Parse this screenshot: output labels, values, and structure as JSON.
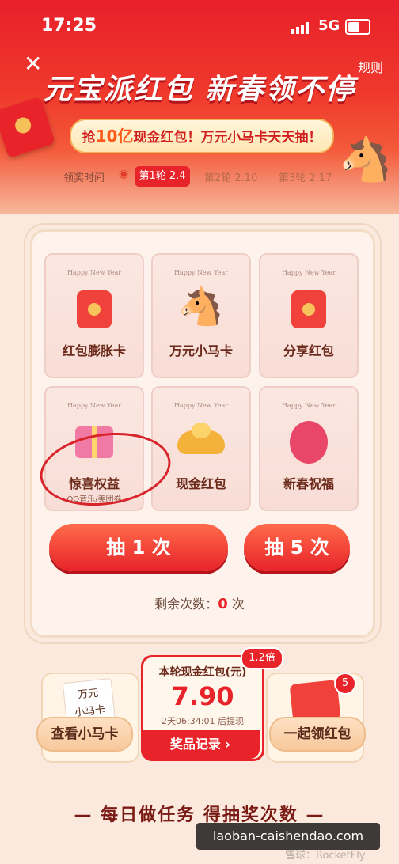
{
  "status_bar": {
    "time": "17:25",
    "network": "5G"
  },
  "header": {
    "close_icon": "close-icon",
    "rules_label": "规则",
    "title": "元宝派红包 新春领不停",
    "banner": {
      "pre": "抢",
      "highlight": "10亿",
      "post": "现金红包！万元小马卡天天抽！"
    }
  },
  "rounds": {
    "label": "领奖时间",
    "items": [
      "第1轮 2.4",
      "第2轮 2.10",
      "第3轮 2.17"
    ],
    "selected_index": 0
  },
  "prizes": [
    {
      "header": "Happy New Year",
      "icon": "red-envelope-icon",
      "label": "红包膨胀卡",
      "sub": ""
    },
    {
      "header": "Happy New Year",
      "icon": "horse-icon",
      "label": "万元小马卡",
      "sub": ""
    },
    {
      "header": "Happy New Year",
      "icon": "red-envelope-icon",
      "label": "分享红包",
      "sub": ""
    },
    {
      "header": "Happy New Year",
      "icon": "gift-box-icon",
      "label": "惊喜权益",
      "sub": "QQ音乐/美团券"
    },
    {
      "header": "Happy New Year",
      "icon": "gold-ingot-icon",
      "label": "现金红包",
      "sub": ""
    },
    {
      "header": "Happy New Year",
      "icon": "lantern-icon",
      "label": "新春祝福",
      "sub": ""
    }
  ],
  "draw_buttons": {
    "draw_one": "抽 1 次",
    "draw_five": "抽 5 次"
  },
  "remaining": {
    "prefix": "剩余次数：",
    "count": "0",
    "suffix": " 次"
  },
  "bottom": {
    "left_card_text": "万元\n小马卡",
    "left_button": "查看小马卡",
    "center": {
      "title": "本轮现金红包(元)",
      "amount": "7.90",
      "multiplier": "1.2倍",
      "countdown": "2天06:34:01 后提现",
      "records_button": "奖品记录 ›"
    },
    "right_badge": "5",
    "right_button": "一起领红包"
  },
  "tasks_heading": "— 每日做任务 得抽奖次数 —",
  "watermark": "laoban-caishendao.com",
  "source_mark": "雪球：RocketFly",
  "colors": {
    "primary_red": "#e8232a",
    "background": "#fbe9de",
    "gold": "#f5c158"
  }
}
